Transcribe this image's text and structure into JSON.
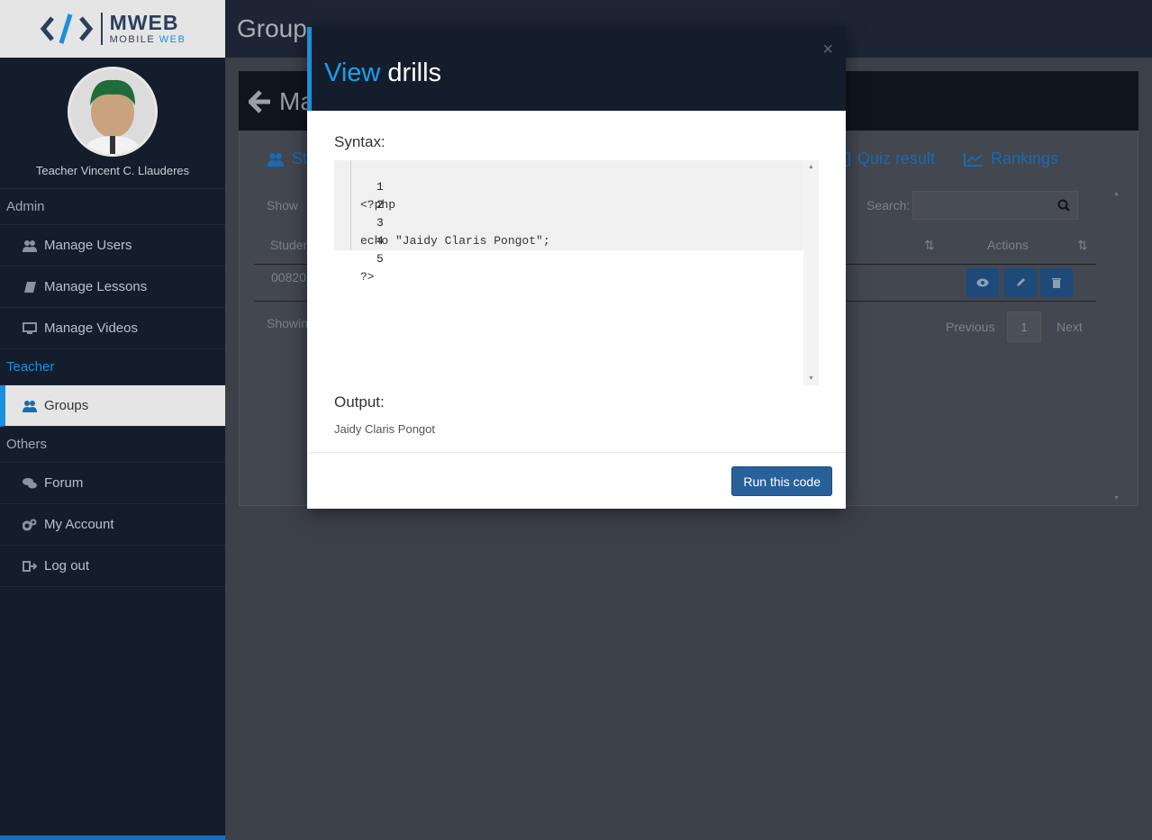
{
  "brand": {
    "title": "MWEB",
    "subtitle_a": "MOBILE",
    "subtitle_b": "WEB"
  },
  "profile": {
    "name": "Teacher Vincent C. Llauderes"
  },
  "sidebar": {
    "sections": [
      {
        "label": "Admin"
      },
      {
        "label": "Teacher"
      },
      {
        "label": "Others"
      }
    ],
    "items": [
      {
        "label": "Manage Users",
        "icon": "users-icon"
      },
      {
        "label": "Manage Lessons",
        "icon": "book-icon"
      },
      {
        "label": "Manage Videos",
        "icon": "monitor-icon"
      },
      {
        "label": "Groups",
        "icon": "users-icon",
        "active": true
      },
      {
        "label": "Forum",
        "icon": "comments-icon"
      },
      {
        "label": "My Account",
        "icon": "cogs-icon"
      },
      {
        "label": "Log out",
        "icon": "sign-out-icon"
      }
    ]
  },
  "background": {
    "group_title_prefix": "Group",
    "group_title_name": "",
    "back_title": "Ma",
    "tabs": [
      {
        "label": "St"
      },
      {
        "label": "Quiz result"
      },
      {
        "label": "Rankings"
      }
    ],
    "show_label": "Show",
    "search_label": "Search:",
    "student_header": "Studen",
    "actions_header": "Actions",
    "row_id": "00820",
    "showing": "Showin",
    "pagination": {
      "previous": "Previous",
      "page": "1",
      "next": "Next"
    }
  },
  "modal": {
    "title_highlight": "View",
    "title_rest": "drills",
    "close": "×",
    "syntax_label": "Syntax:",
    "code_lines": [
      {
        "n": "1",
        "text": "<?php"
      },
      {
        "n": "2",
        "text": ""
      },
      {
        "n": "3",
        "text": "echo \"Jaidy Claris Pongot\";"
      },
      {
        "n": "4",
        "text": ""
      },
      {
        "n": "5",
        "text": "?>"
      }
    ],
    "output_label": "Output:",
    "output_text": "Jaidy Claris Pongot",
    "run_button": "Run this code"
  },
  "colors": {
    "accent": "#1a8fe0",
    "sidebar_bg": "#141d2b",
    "button_bg": "#28609a"
  }
}
